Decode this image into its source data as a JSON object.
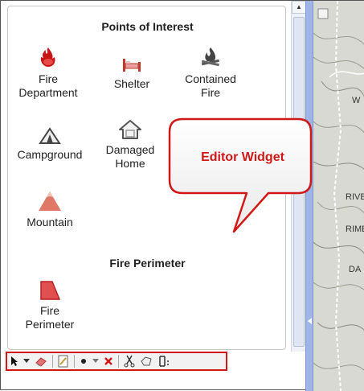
{
  "panel": {
    "points_title": "Points of Interest",
    "perimeter_title": "Fire Perimeter",
    "points": [
      {
        "label_lines": [
          "Fire",
          "Department"
        ],
        "icon": "fire-department-icon"
      },
      {
        "label_lines": [
          "Shelter"
        ],
        "icon": "shelter-icon"
      },
      {
        "label_lines": [
          "Contained",
          "Fire"
        ],
        "icon": "contained-fire-icon"
      },
      {
        "label_lines": [
          "Campground"
        ],
        "icon": "campground-icon"
      },
      {
        "label_lines": [
          "Damaged",
          "Home"
        ],
        "icon": "damaged-home-icon"
      },
      {
        "label_lines": [
          "Mountain"
        ],
        "icon": "mountain-icon"
      }
    ],
    "perimeter": [
      {
        "label_lines": [
          "Fire",
          "Perimeter"
        ],
        "icon": "fire-perimeter-icon"
      }
    ]
  },
  "callout": {
    "text": "Editor Widget",
    "color": "#d01818"
  },
  "toolbar": {
    "tools": [
      "select-arrow-icon",
      "dropdown-icon",
      "eraser-icon",
      "edit-attributes-icon",
      "point-icon",
      "dropdown-icon",
      "delete-icon",
      "cut-icon",
      "reshape-icon",
      "merge-icon"
    ]
  },
  "map": {
    "labels": [
      "W",
      "RIVE",
      "RIME",
      "DA"
    ]
  }
}
